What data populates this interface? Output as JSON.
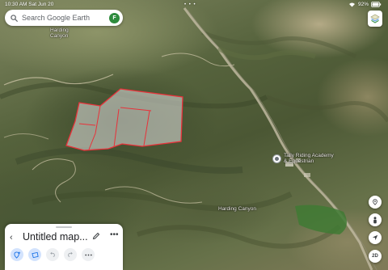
{
  "status_bar": {
    "time": "10:30 AM  Sat Jun 20",
    "dots": "• • •",
    "battery": "92%"
  },
  "search": {
    "placeholder": "Search Google Earth",
    "avatar_letter": "F"
  },
  "map_labels": {
    "harding_canyon": "Harding\nCanyon",
    "academy": "Tally Riding Academy\n& Equestrian",
    "canyon_road": "Harding Canyon"
  },
  "side_controls": {
    "view_2d": "2D"
  },
  "map_panel": {
    "title": "Untitled map...",
    "back_glyph": "‹",
    "more_glyph": "•••"
  },
  "colors": {
    "polygon_stroke": "#e8323a",
    "polygon_fill": "rgba(230,230,230,0.55)",
    "avatar": "#2e8b3d",
    "active_tool": "#d3e3fd"
  }
}
